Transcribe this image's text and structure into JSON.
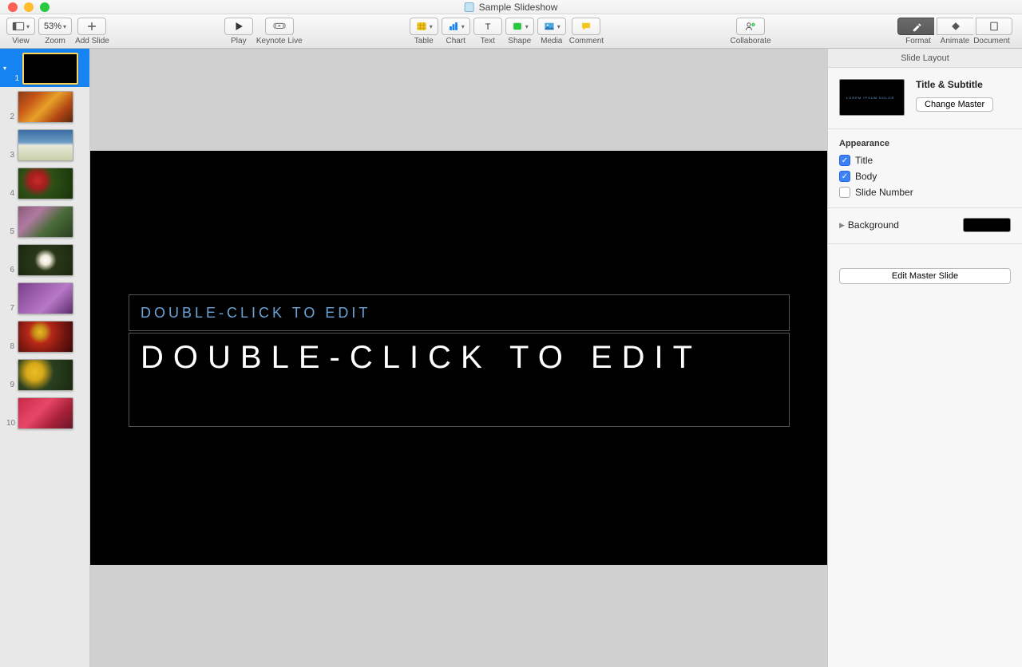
{
  "window": {
    "title": "Sample Slideshow"
  },
  "toolbar": {
    "view_label": "View",
    "zoom_label": "Zoom",
    "zoom_value": "53%",
    "add_slide_label": "Add Slide",
    "play_label": "Play",
    "keynote_live_label": "Keynote Live",
    "table_label": "Table",
    "chart_label": "Chart",
    "text_label": "Text",
    "shape_label": "Shape",
    "media_label": "Media",
    "comment_label": "Comment",
    "collaborate_label": "Collaborate",
    "format_label": "Format",
    "animate_label": "Animate",
    "document_label": "Document"
  },
  "slides": [
    {
      "num": "1",
      "selected": true,
      "type": "black"
    },
    {
      "num": "2",
      "selected": false,
      "type": "img2"
    },
    {
      "num": "3",
      "selected": false,
      "type": "img3"
    },
    {
      "num": "4",
      "selected": false,
      "type": "img4"
    },
    {
      "num": "5",
      "selected": false,
      "type": "img5"
    },
    {
      "num": "6",
      "selected": false,
      "type": "img6"
    },
    {
      "num": "7",
      "selected": false,
      "type": "img7"
    },
    {
      "num": "8",
      "selected": false,
      "type": "img8"
    },
    {
      "num": "9",
      "selected": false,
      "type": "img9"
    },
    {
      "num": "10",
      "selected": false,
      "type": "img10"
    }
  ],
  "canvas": {
    "subtitle_placeholder": "DOUBLE-CLICK TO EDIT",
    "title_placeholder": "DOUBLE-CLICK TO EDIT"
  },
  "inspector": {
    "header": "Slide Layout",
    "master_name": "Title & Subtitle",
    "master_thumb_line1": "LOREM IPSUM DOLOR",
    "master_thumb_line2": "",
    "change_master": "Change Master",
    "appearance_label": "Appearance",
    "title_check": "Title",
    "body_check": "Body",
    "slide_number_check": "Slide Number",
    "title_checked": true,
    "body_checked": true,
    "slide_number_checked": false,
    "background_label": "Background",
    "background_color": "#000000",
    "edit_master_slide": "Edit Master Slide"
  }
}
